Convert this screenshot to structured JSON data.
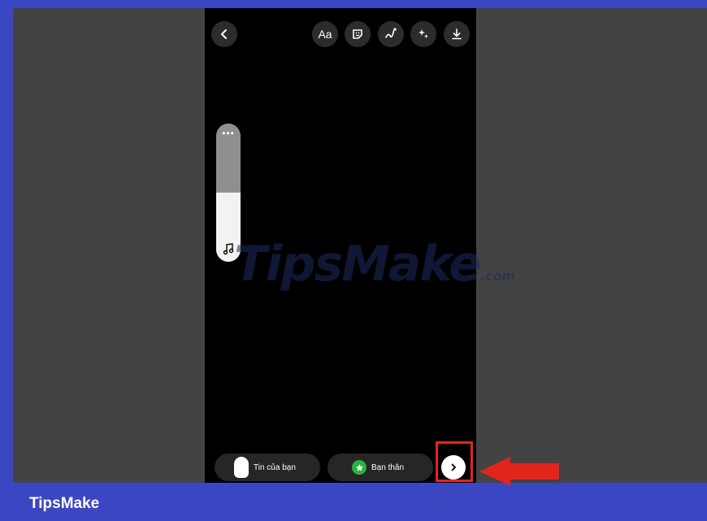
{
  "top_toolbar": {
    "back_icon": "chevron-left-icon",
    "text_label": "Aa",
    "sticker_icon": "sticker-icon",
    "draw_icon": "draw-squiggle-icon",
    "effects_icon": "sparkles-icon",
    "download_icon": "download-icon"
  },
  "music_slider": {
    "menu_glyph": "•••",
    "level": 0.5,
    "icon": "music-note-icon"
  },
  "bottom_bar": {
    "your_story_label": "Tin của bạn",
    "close_friends_label": "Bạn thân",
    "next_icon": "chevron-right-icon"
  },
  "watermark": {
    "text": "TipsMake",
    "suffix": ".com"
  },
  "footer": {
    "brand": "TipsMake"
  },
  "colors": {
    "frame_blue": "#3b46c2",
    "highlight_red": "#e3241b",
    "close_friends_green": "#27b53d"
  }
}
